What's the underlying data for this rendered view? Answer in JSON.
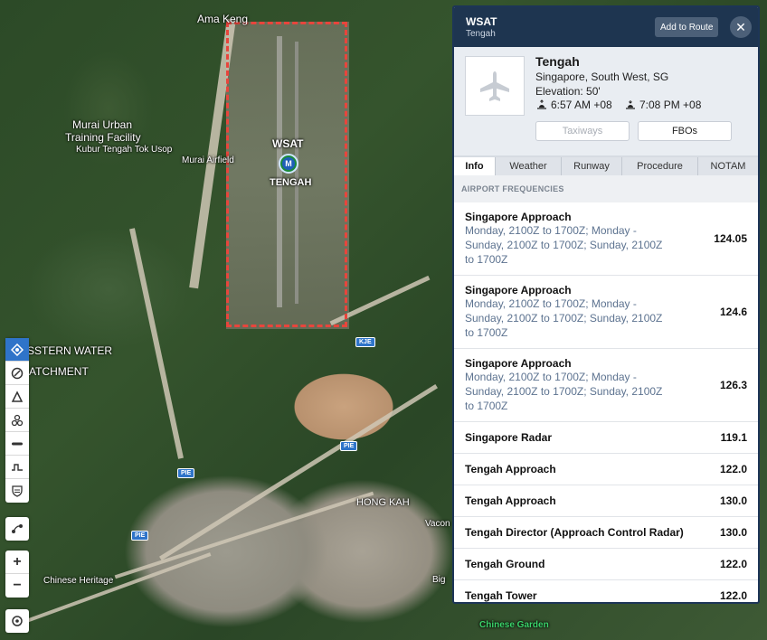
{
  "map": {
    "labels": {
      "ama_keng": "Ama Keng",
      "murai_urban": "Murai Urban",
      "training_facility": "Training Facility",
      "kubur_tengah": "Kubur Tengah Tok Usop",
      "murai_airfield": "Murai Airfield",
      "western_water": "SSTERN WATER",
      "catchment": "ATCHMENT",
      "chinese_heritage": "Chinese Heritage",
      "chinese_garden": "Chinese Garden",
      "hong_kah": "HONG KAH",
      "big": "Big",
      "vacon": "Vacon"
    },
    "highways": {
      "kje": "KJE",
      "pie1": "PIE",
      "pie2": "PIE",
      "pie3": "PIE"
    },
    "airport_marker": {
      "code": "WSAT",
      "name": "TENGAH",
      "symbol": "M"
    }
  },
  "toolbar": {
    "tools": [
      "crosshair-icon",
      "compass-icon",
      "triangle-icon",
      "cluster-icon",
      "line-icon",
      "step-icon",
      "shield-icon",
      "route-icon",
      "plus",
      "minus",
      "target-icon"
    ],
    "zoom_in": "+",
    "zoom_out": "−"
  },
  "panel": {
    "code": "WSAT",
    "name": "Tengah",
    "add_route": "Add to Route",
    "close": "✕",
    "card": {
      "title": "Tengah",
      "location": "Singapore, South West, SG",
      "elevation": "Elevation: 50'",
      "sunrise": "6:57 AM +08",
      "sunset": "7:08 PM +08",
      "taxiways": "Taxiways",
      "fbos": "FBOs"
    },
    "tabs": [
      "Info",
      "Weather",
      "Runway",
      "Procedure",
      "NOTAM"
    ],
    "section_title": "AIRPORT FREQUENCIES",
    "frequencies": [
      {
        "name": "Singapore Approach",
        "hours": "Monday, 2100Z to 1700Z; Monday - Sunday, 2100Z to 1700Z; Sunday, 2100Z to 1700Z",
        "value": "124.05"
      },
      {
        "name": "Singapore Approach",
        "hours": "Monday, 2100Z to 1700Z; Monday - Sunday, 2100Z to 1700Z; Sunday, 2100Z to 1700Z",
        "value": "124.6"
      },
      {
        "name": "Singapore Approach",
        "hours": "Monday, 2100Z to 1700Z; Monday - Sunday, 2100Z to 1700Z; Sunday, 2100Z to 1700Z",
        "value": "126.3"
      },
      {
        "name": "Singapore Radar",
        "hours": "",
        "value": "119.1"
      },
      {
        "name": "Tengah Approach",
        "hours": "",
        "value": "122.0"
      },
      {
        "name": "Tengah Approach",
        "hours": "",
        "value": "130.0"
      },
      {
        "name": "Tengah Director (Approach Control Radar)",
        "hours": "",
        "value": "130.0"
      },
      {
        "name": "Tengah Ground",
        "hours": "",
        "value": "122.0"
      },
      {
        "name": "Tengah Tower",
        "hours": "",
        "value": "122.0"
      }
    ]
  }
}
